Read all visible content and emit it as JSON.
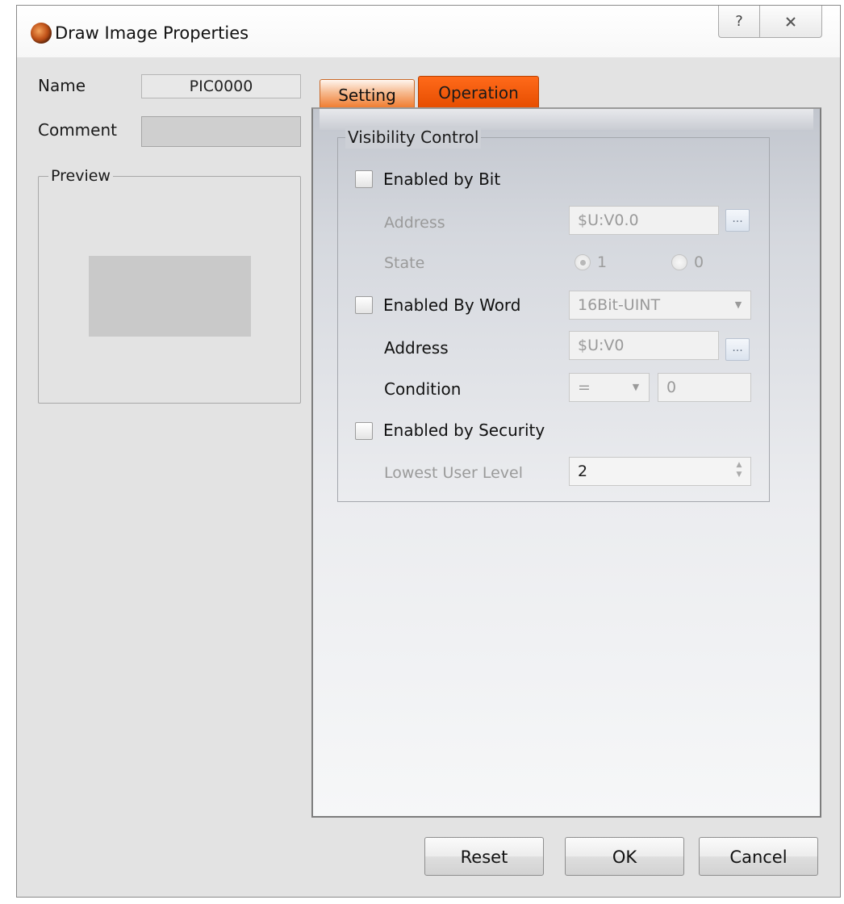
{
  "window": {
    "title": "Draw Image Properties",
    "help_glyph": "?",
    "icon": "app-orb-icon"
  },
  "left": {
    "name_label": "Name",
    "name_value": "PIC0000",
    "comment_label": "Comment",
    "comment_value": "",
    "preview_label": "Preview"
  },
  "tabs": [
    {
      "label": "Setting",
      "active": false
    },
    {
      "label": "Operation",
      "active": true
    }
  ],
  "visibility": {
    "group_label": "Visibility Control",
    "by_bit": {
      "label": "Enabled by Bit",
      "checked": false,
      "address_label": "Address",
      "address_value": "$U:V0.0",
      "state_label": "State",
      "state_options": [
        "1",
        "0"
      ],
      "state_selected": "1"
    },
    "by_word": {
      "label": "Enabled By Word",
      "checked": false,
      "data_type": "16Bit-UINT",
      "address_label": "Address",
      "address_value": "$U:V0",
      "condition_label": "Condition",
      "condition_operator": "=",
      "condition_value": "0"
    },
    "by_security": {
      "label": "Enabled by Security",
      "checked": false,
      "level_label": "Lowest User Level",
      "level_value": "2"
    },
    "browse_glyph": "..."
  },
  "buttons": {
    "reset": "Reset",
    "ok": "OK",
    "cancel": "Cancel"
  },
  "colors": {
    "active_tab": "#e64d00",
    "inactive_tab": "#f07a2c",
    "dialog_bg": "#e3e3e3"
  }
}
